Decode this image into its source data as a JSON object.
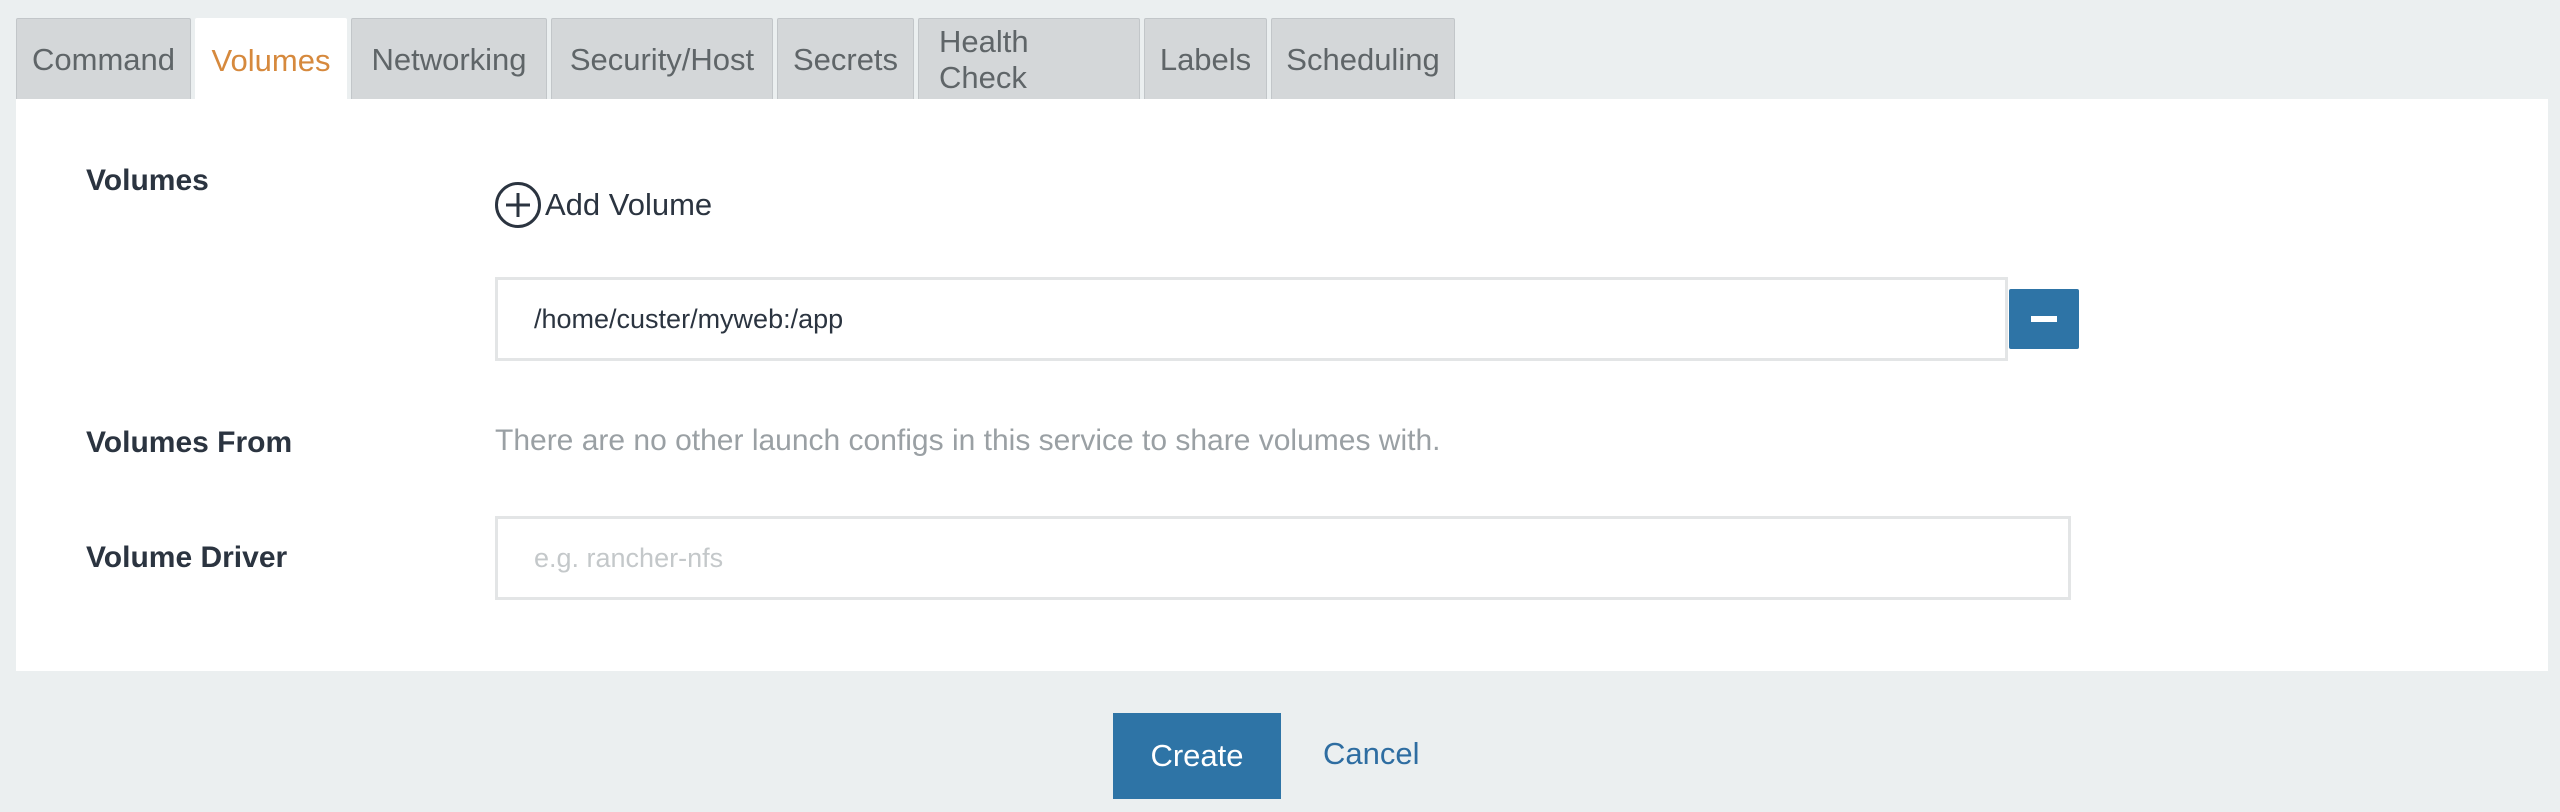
{
  "tabs": [
    {
      "label": "Command",
      "active": false
    },
    {
      "label": "Volumes",
      "active": true
    },
    {
      "label": "Networking",
      "active": false
    },
    {
      "label": "Security/Host",
      "active": false
    },
    {
      "label": "Secrets",
      "active": false
    },
    {
      "label": "Health Check",
      "active": false
    },
    {
      "label": "Labels",
      "active": false
    },
    {
      "label": "Scheduling",
      "active": false
    }
  ],
  "volumes": {
    "label": "Volumes",
    "add_label": "Add Volume",
    "entry_value": "/home/custer/myweb:/app"
  },
  "volumes_from": {
    "label": "Volumes From",
    "message": "There are no other launch configs in this service to share volumes with."
  },
  "volume_driver": {
    "label": "Volume Driver",
    "placeholder": "e.g. rancher-nfs",
    "value": ""
  },
  "actions": {
    "create_label": "Create",
    "cancel_label": "Cancel"
  },
  "colors": {
    "accent": "#d6893d",
    "primary": "#2e74a6",
    "background": "#ebeff0"
  }
}
